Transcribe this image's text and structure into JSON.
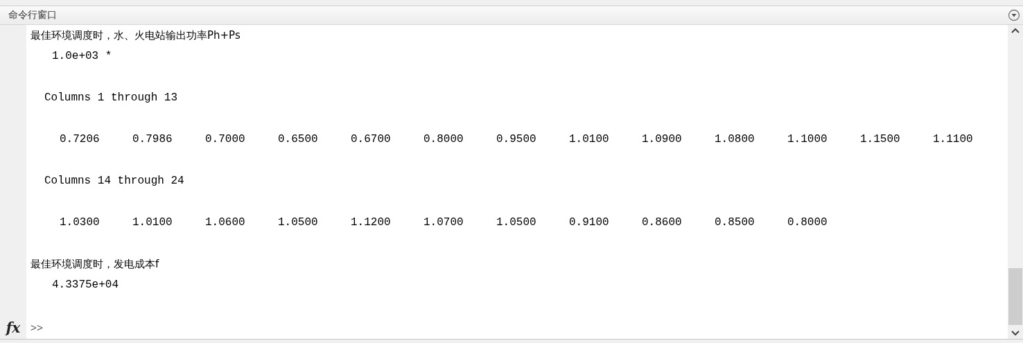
{
  "window": {
    "title": "命令行窗口"
  },
  "output": [
    {
      "kind": "text",
      "text": "最佳环境调度时，水、火电站输出功率Ph+Ps"
    },
    {
      "kind": "scale",
      "text": "1.0e+03 *"
    },
    {
      "kind": "header",
      "text": "Columns 1 through 13"
    },
    {
      "kind": "values",
      "values": [
        "0.7206",
        "0.7986",
        "0.7000",
        "0.6500",
        "0.6700",
        "0.8000",
        "0.9500",
        "1.0100",
        "1.0900",
        "1.0800",
        "1.1000",
        "1.1500",
        "1.1100"
      ]
    },
    {
      "kind": "header",
      "text": "Columns 14 through 24"
    },
    {
      "kind": "values",
      "values": [
        "1.0300",
        "1.0100",
        "1.0600",
        "1.0500",
        "1.1200",
        "1.0700",
        "1.0500",
        "0.9100",
        "0.8600",
        "0.8500",
        "0.8000"
      ]
    },
    {
      "kind": "text",
      "text": "最佳环境调度时，发电成本f"
    },
    {
      "kind": "scale",
      "text": "4.3375e+04"
    }
  ],
  "prompt": ">>",
  "function_button": "fx"
}
